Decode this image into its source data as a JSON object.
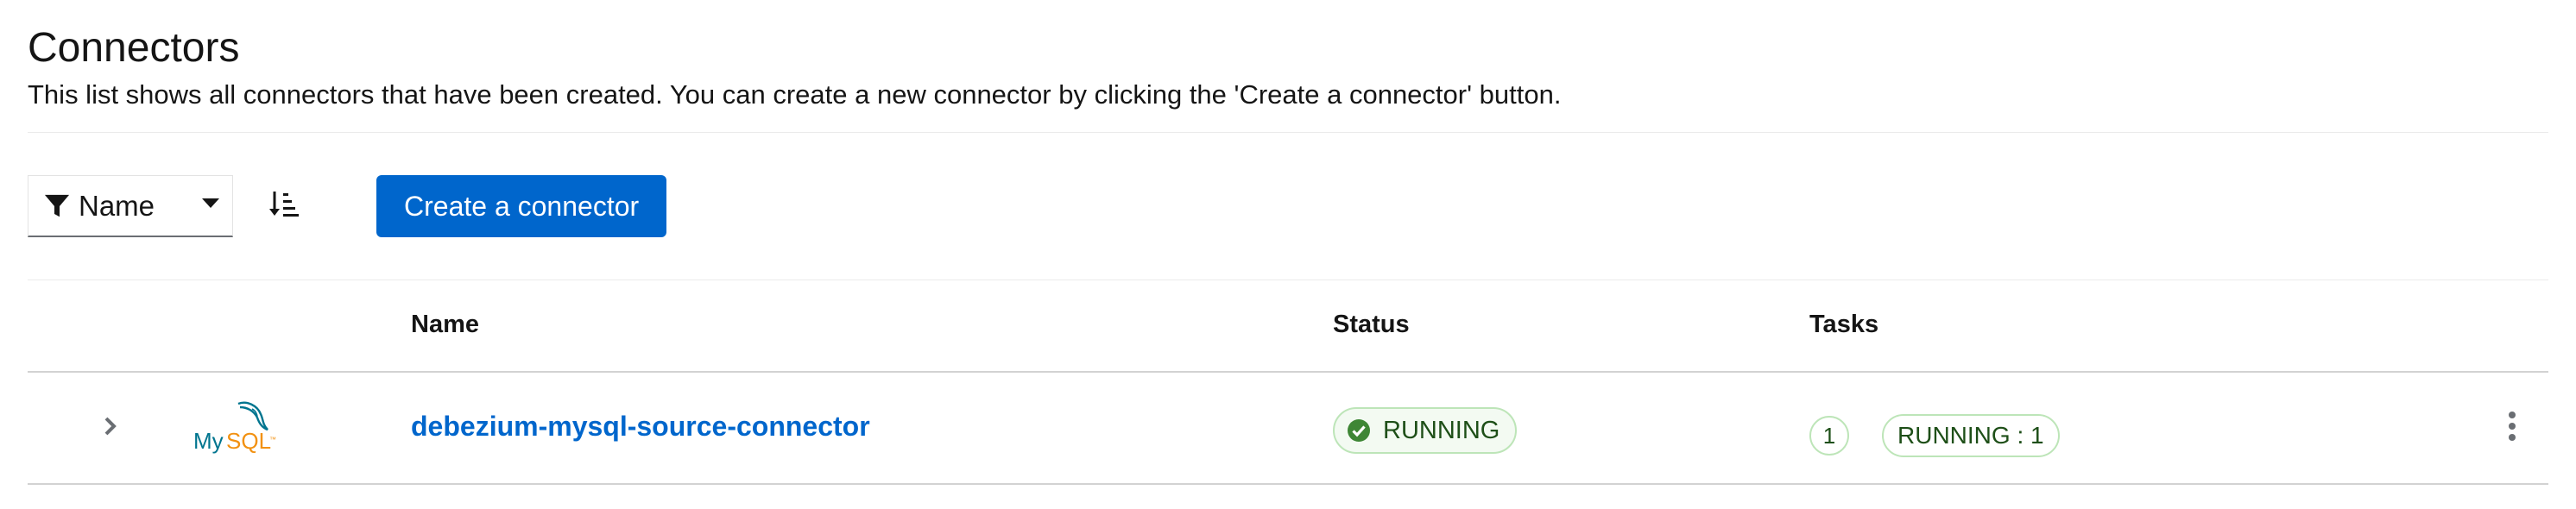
{
  "header": {
    "title": "Connectors",
    "description": "This list shows all connectors that have been created. You can create a new connector by clicking the 'Create a connector' button."
  },
  "toolbar": {
    "filter_label": "Name",
    "create_label": "Create a connector"
  },
  "table": {
    "columns": [
      "Name",
      "Status",
      "Tasks"
    ],
    "rows": [
      {
        "logo_text": "MySQL",
        "name": "debezium-mysql-source-connector",
        "status": "RUNNING",
        "task_count": "1",
        "task_status": "RUNNING : 1"
      }
    ]
  },
  "colors": {
    "primary": "#0066cc",
    "success_border": "#bde5b8",
    "success_text": "#1e4f18",
    "success_icon": "#3e8635",
    "mysql_blue": "#00758f",
    "mysql_orange": "#f29111"
  },
  "icons": {
    "filter": "filter-icon",
    "dropdown": "caret-down-icon",
    "sort": "sort-amount-down-icon",
    "expand": "chevron-right-icon",
    "status": "check-circle-icon",
    "actions": "kebab-menu-icon"
  }
}
